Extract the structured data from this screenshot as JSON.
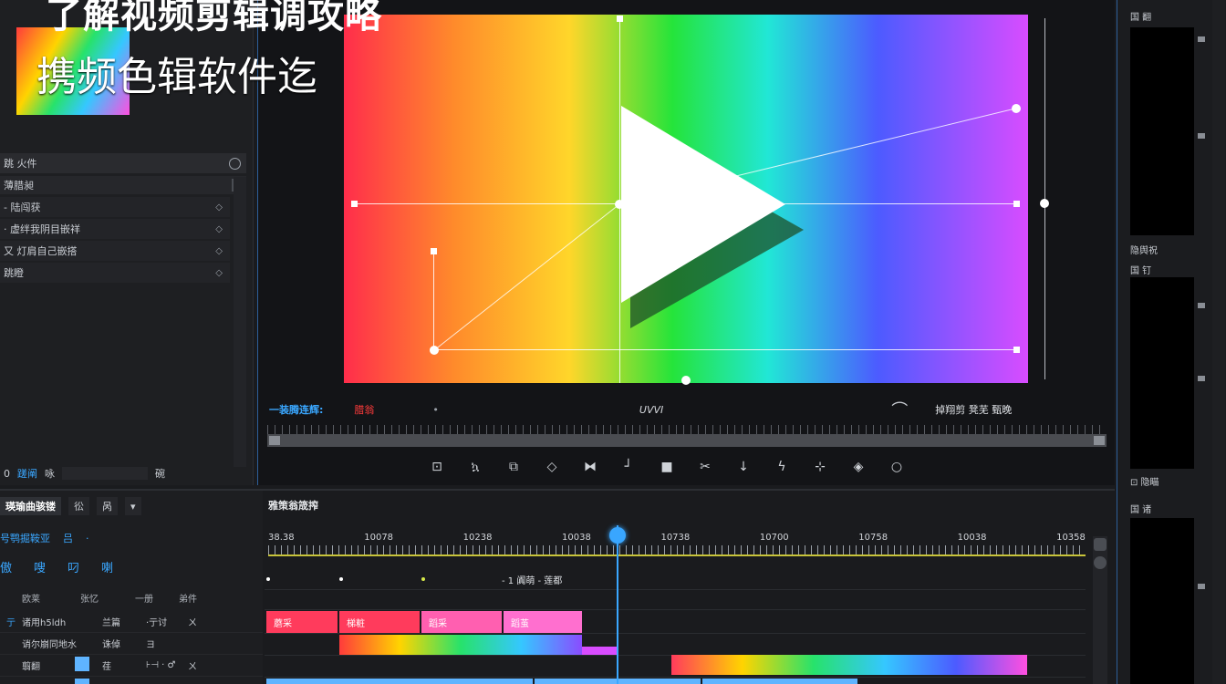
{
  "banner": {
    "title": "了解视频剪辑调攻略",
    "subtitle": "携频色辑软件迄"
  },
  "left_panel": {
    "header": "跳 火件",
    "subheader": "薄腊昶",
    "items": [
      {
        "label": "- 陆闯获"
      },
      {
        "label": "· 虚绊我阴目嵌祥"
      },
      {
        "label": "又 灯肩自己嵌搭"
      },
      {
        "label": "跳瞪"
      }
    ],
    "footer": {
      "left": "0",
      "active": "蹉阐",
      "mid": "咏",
      "right": "碗"
    }
  },
  "preview": {
    "controls": {
      "label": "一装腾连辉:",
      "red_label": "腊翁",
      "dot": "•",
      "mid": "UVVI",
      "caret": "⌒",
      "right": "掉翔剪 凳芜 甄晚"
    },
    "tools": [
      "⊡",
      "ኳ",
      "⧉",
      "◇",
      "⧓",
      "┘",
      "■",
      "✂",
      "↓",
      "ϟ",
      "⊹",
      "◈",
      "○"
    ]
  },
  "right_panel": {
    "labels": [
      "国 翻",
      "隐舆祝",
      "国 钉",
      "⊡ 隐瞄",
      "国 诸"
    ]
  },
  "bottom_left": {
    "tabs": [
      "瑛瑜曲骇镂",
      "彸",
      "呙",
      "▾"
    ],
    "row1": [
      "号鹗掘鞍亚",
      "吕",
      "·"
    ],
    "row2": [
      "傲",
      "嗖",
      "叼",
      "喇"
    ],
    "headers": [
      "欧莱",
      "张忆",
      "一册",
      "弟件"
    ],
    "tracks": [
      {
        "icon": "亍",
        "name": "诸用h5ldh",
        "a": "兰篇",
        "b": "·亍讨",
        "c": "ㄨ"
      },
      {
        "icon": "",
        "name": "诮尔崩同地水",
        "a": "诛倬",
        "b": "ヨ",
        "c": ""
      },
      {
        "icon": "",
        "name": "翦翻",
        "a": "荏",
        "b": "⊦⊣ · ♂",
        "c": "ㄨ"
      },
      {
        "icon": "",
        "name": "",
        "a": "",
        "b": "",
        "c": ""
      }
    ]
  },
  "timeline": {
    "title": "雅策翁筬搾",
    "ticks": [
      "38.38",
      "10078",
      "10238",
      "10038",
      "10738",
      "10700",
      "10758",
      "10038",
      "10358"
    ],
    "marker_note": "- 1 阗萌 - 莲都",
    "clips_top": [
      "蘑采",
      "梯粧",
      "蹈采",
      "蹈茧"
    ]
  },
  "colors": {
    "accent": "#3aa7ff",
    "clip_red": "#ff3b5c",
    "clip_pink": "#ff5fb0"
  }
}
